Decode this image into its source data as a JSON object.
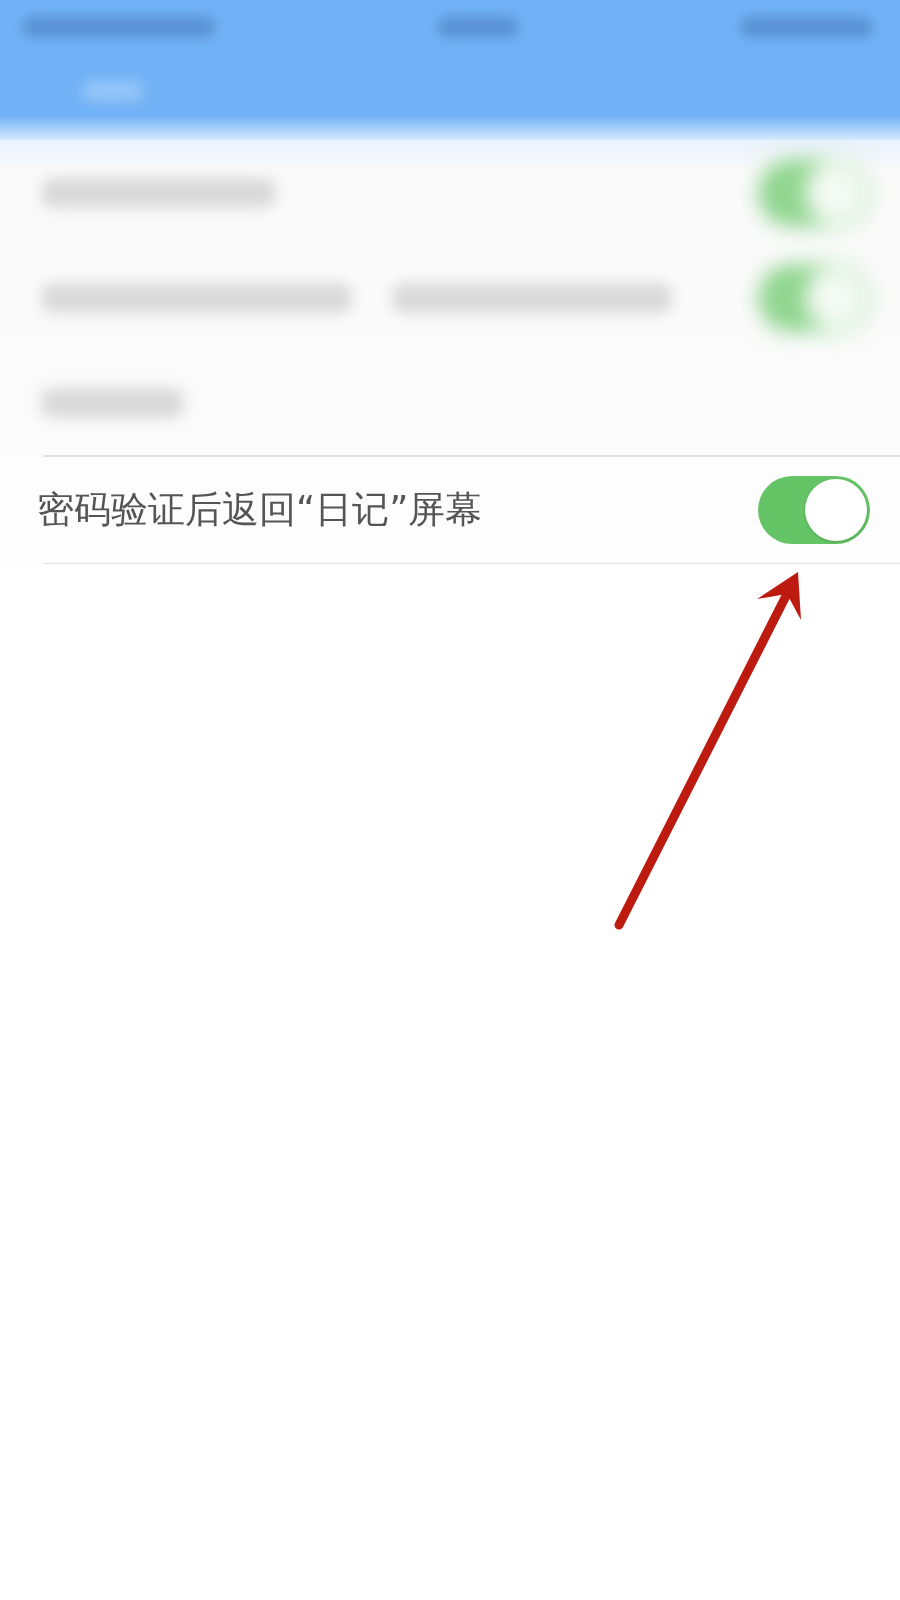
{
  "blurred_rows": [
    {
      "kind": "toggle",
      "on": true
    },
    {
      "kind": "toggle",
      "on": true
    },
    {
      "kind": "plain"
    }
  ],
  "setting": {
    "label": "密码验证后返回“日记”屏幕",
    "on": true
  },
  "annotations": [
    {
      "kind": "arrow"
    }
  ]
}
